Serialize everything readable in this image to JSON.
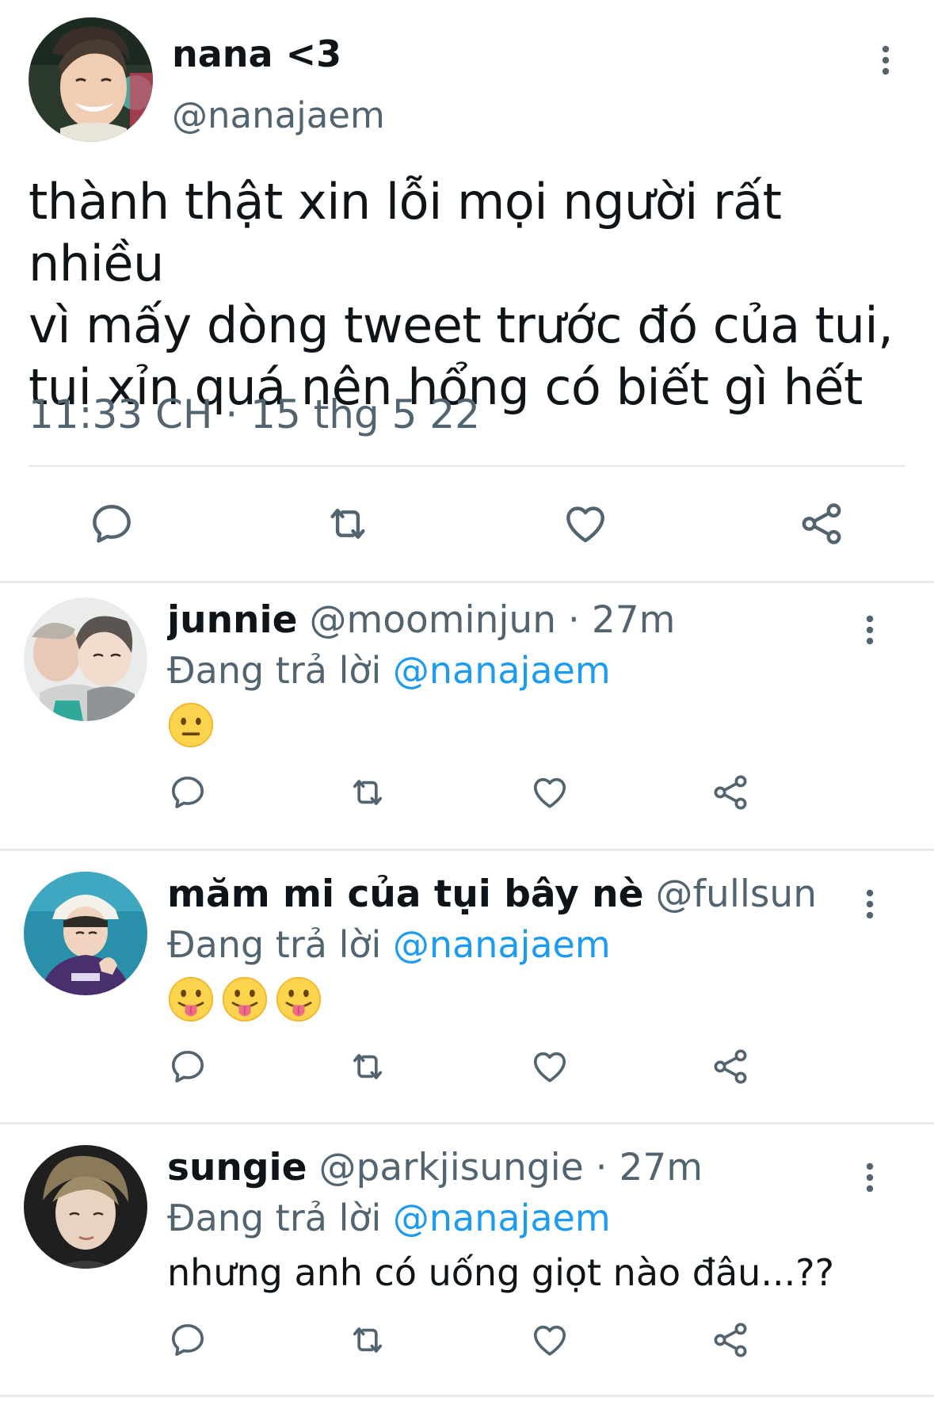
{
  "main_tweet": {
    "author_name": "nana <3",
    "author_handle": "@nanajaem",
    "text": "thành thật xin lỗi mọi người rất nhiều\nvì mấy dòng tweet trước đó của tui,\ntui xỉn quá nên hổng có biết gì hết",
    "timestamp": "11:33 CH · 15 thg 5 22",
    "menu_icon": "more-vertical-icon",
    "actions": [
      "reply-icon",
      "retweet-icon",
      "like-icon",
      "share-icon"
    ]
  },
  "replies": [
    {
      "name": "junnie",
      "meta": "@moominjun · 27m",
      "replying_label": "Đang trả lời",
      "replying_to": "@nanajaem",
      "body": "",
      "emoji": [
        "neutral-face-emoji"
      ]
    },
    {
      "name": "măm mi của tụi bây nè",
      "meta": "@fullsun · …",
      "replying_label": "Đang trả lời",
      "replying_to": "@nanajaem",
      "body": "",
      "emoji": [
        "tongue-face-emoji",
        "tongue-face-emoji",
        "tongue-face-emoji"
      ]
    },
    {
      "name": "sungie",
      "meta": "@parkjisungie · 27m",
      "replying_label": "Đang trả lời",
      "replying_to": "@nanajaem",
      "body": "nhưng anh có uống giọt nào đâu...??",
      "emoji": []
    }
  ],
  "colors": {
    "text": "#0f1419",
    "secondary": "#536471",
    "link": "#1d9bf0",
    "divider": "#e7e9ea"
  }
}
